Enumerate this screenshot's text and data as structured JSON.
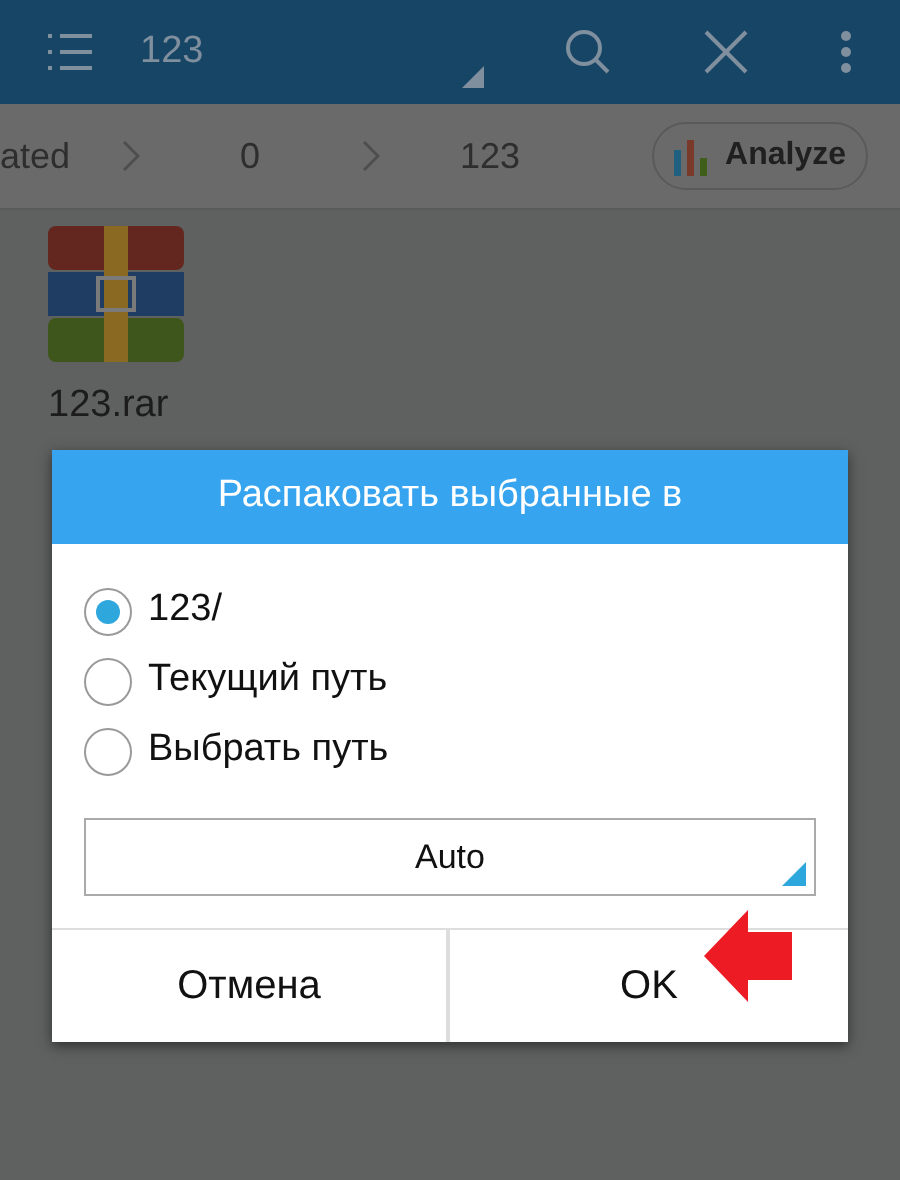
{
  "app_bar": {
    "title": "123"
  },
  "breadcrumbs": [
    {
      "label": "ated"
    },
    {
      "label": "0"
    },
    {
      "label": "123"
    }
  ],
  "analyze_button": "Analyze",
  "files": [
    {
      "name": "123.rar"
    }
  ],
  "dialog": {
    "title": "Распаковать выбранные в",
    "options": [
      {
        "label": "123/",
        "selected": true
      },
      {
        "label": "Текущий путь",
        "selected": false
      },
      {
        "label": "Выбрать путь",
        "selected": false
      }
    ],
    "dropdown": {
      "value": "Auto"
    },
    "buttons": [
      "Отмена",
      "OK"
    ]
  }
}
